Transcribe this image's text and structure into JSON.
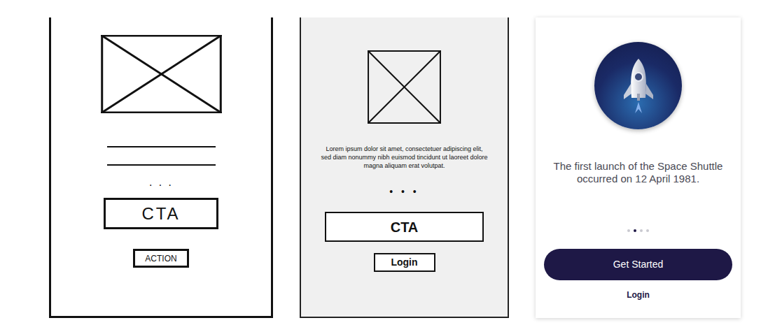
{
  "sketch": {
    "dots": "· · ·",
    "cta": "CTA",
    "action": "ACTION"
  },
  "wireframe": {
    "body": "Lorem ipsum dolor sit amet, consectetuer adipiscing elit, sed diam nonummy nibh euismod tincidunt ut laoreet dolore magna aliquam erat volutpat.",
    "dots": "• • •",
    "cta": "CTA",
    "login": "Login"
  },
  "final": {
    "caption": "The first launch of the Space Shuttle occurred on 12 April 1981.",
    "pager": [
      {
        "selected": false
      },
      {
        "selected": true
      },
      {
        "selected": false
      },
      {
        "selected": false
      }
    ],
    "button": "Get Started",
    "login": "Login"
  }
}
